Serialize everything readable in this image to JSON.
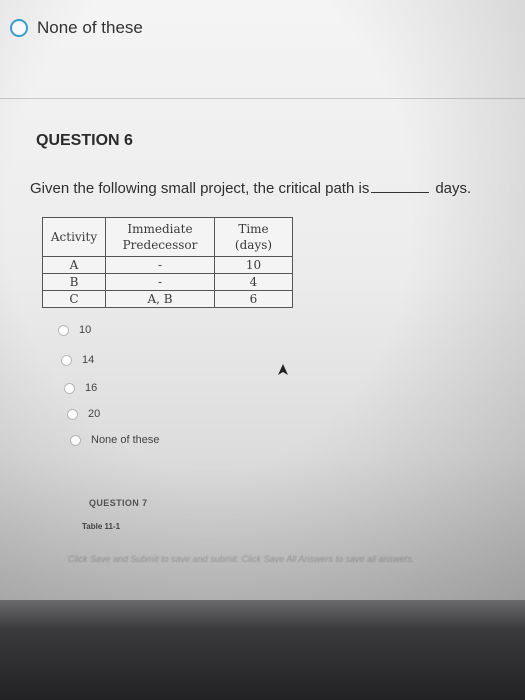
{
  "previous_question": {
    "option_label": "None of these"
  },
  "question": {
    "title": "QUESTION 6",
    "text_before": "Given the following small project, the critical path is",
    "text_after": "days.",
    "table": {
      "headers": {
        "activity": "Activity",
        "predecessor_line1": "Immediate",
        "predecessor_line2": "Predecessor",
        "time_line1": "Time",
        "time_line2": "(days)"
      },
      "rows": [
        {
          "activity": "A",
          "predecessor": "-",
          "time": "10"
        },
        {
          "activity": "B",
          "predecessor": "-",
          "time": "4"
        },
        {
          "activity": "C",
          "predecessor": "A, B",
          "time": "6"
        }
      ]
    },
    "options": [
      "10",
      "14",
      "16",
      "20",
      "None of these"
    ]
  },
  "next_question": {
    "title": "QUESTION 7",
    "subtitle": "Table 11-1"
  },
  "footer": {
    "instructions": "Click Save and Submit to save and submit. Click Save All Answers to save all answers."
  },
  "colors": {
    "radio_selected_ring": "#3aa0d8"
  }
}
